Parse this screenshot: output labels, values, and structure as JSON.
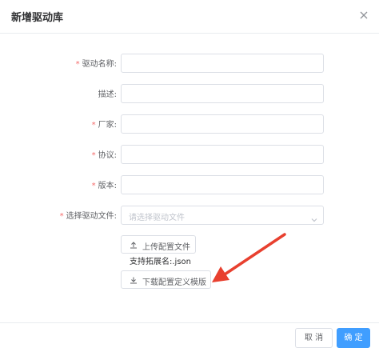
{
  "dialog": {
    "title": "新增驱动库",
    "close_icon": "close-icon"
  },
  "form": {
    "required_mark": "*",
    "fields": [
      {
        "label": "驱动名称:",
        "required": true,
        "value": ""
      },
      {
        "label": "描述:",
        "required": false,
        "value": ""
      },
      {
        "label": "厂家:",
        "required": true,
        "value": ""
      },
      {
        "label": "协议:",
        "required": true,
        "value": ""
      },
      {
        "label": "版本:",
        "required": true,
        "value": ""
      }
    ],
    "select": {
      "label": "选择驱动文件:",
      "required": true,
      "placeholder": "请选择驱动文件"
    },
    "upload_button": "上传配置文件",
    "upload_hint": "支持拓展名:.json",
    "download_button": "下载配置定义模版"
  },
  "footer": {
    "cancel": "取 消",
    "confirm": "确 定"
  },
  "colors": {
    "primary": "#409eff",
    "required": "#f56c6c",
    "annotation_arrow": "#e8402f"
  }
}
